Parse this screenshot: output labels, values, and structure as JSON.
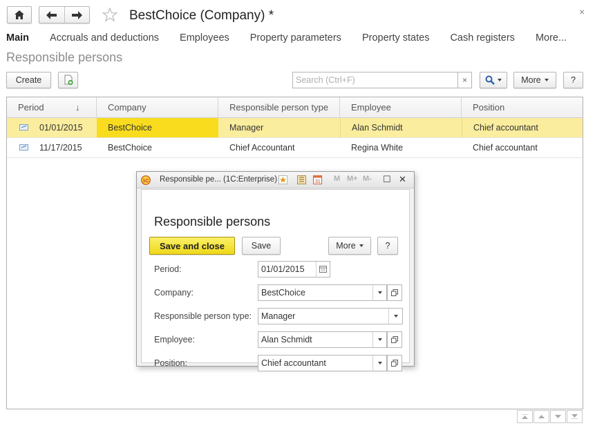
{
  "window": {
    "title": "BestChoice (Company) *",
    "close_glyph": "×"
  },
  "tabs": [
    {
      "label": "Main",
      "active": true
    },
    {
      "label": "Accruals and deductions"
    },
    {
      "label": "Employees"
    },
    {
      "label": "Property parameters"
    },
    {
      "label": "Property states"
    },
    {
      "label": "Cash registers"
    },
    {
      "label": "More..."
    }
  ],
  "section_title": "Responsible persons",
  "toolbar": {
    "create_label": "Create",
    "search_placeholder": "Search (Ctrl+F)",
    "clear_glyph": "×",
    "more_label": "More",
    "help_label": "?"
  },
  "table": {
    "columns": [
      "Period",
      "Company",
      "Responsible person type",
      "Employee",
      "Position"
    ],
    "sort_glyph": "↓",
    "rows": [
      {
        "period": "01/01/2015",
        "company": "BestChoice",
        "type": "Manager",
        "employee": "Alan Schmidt",
        "position": "Chief accountant",
        "selected": true
      },
      {
        "period": "11/17/2015",
        "company": "BestChoice",
        "type": "Chief Accountant",
        "employee": "Regina White",
        "position": "Chief accountant"
      }
    ]
  },
  "dialog": {
    "window_title": "Responsible pe...  (1C:Enterprise)",
    "toolbar_glyphs": {
      "m": "M",
      "m_plus": "M+",
      "m_minus": "M-",
      "maximize": "☐",
      "close": "✕"
    },
    "heading": "Responsible persons",
    "save_and_close_label": "Save and close",
    "save_label": "Save",
    "more_label": "More",
    "help_label": "?",
    "fields": {
      "period": {
        "label": "Period:",
        "value": "01/01/2015"
      },
      "company": {
        "label": "Company:",
        "value": "BestChoice"
      },
      "type": {
        "label": "Responsible person type:",
        "value": "Manager"
      },
      "employee": {
        "label": "Employee:",
        "value": "Alan Schmidt"
      },
      "position": {
        "label": "Position:",
        "value": "Chief accountant"
      }
    }
  },
  "colors": {
    "selected_row": "#fbed9e",
    "current_cell": "#f9dc1d",
    "primary_button": "#f5e52b",
    "section_title": "#8d8d8d"
  }
}
